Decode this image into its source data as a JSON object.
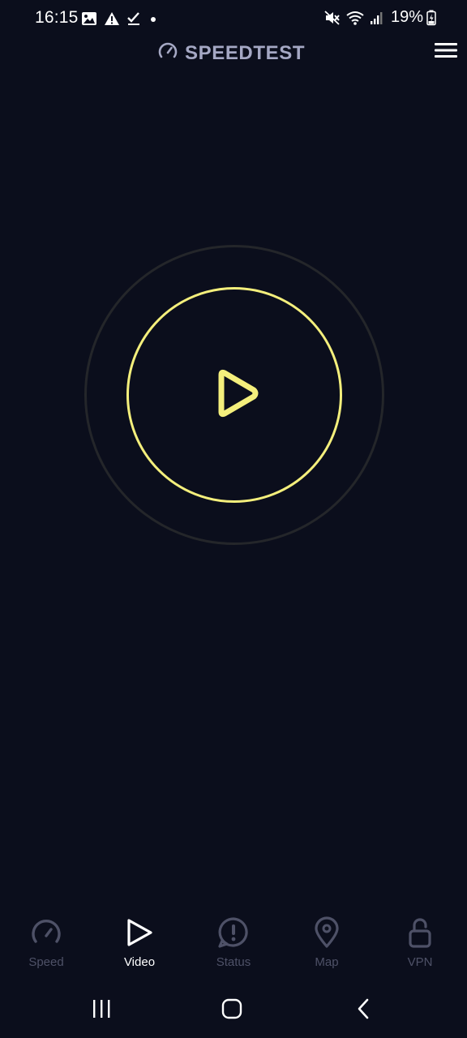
{
  "status_bar": {
    "time": "16:15",
    "battery": "19%",
    "icons": [
      "image-icon",
      "warning-icon",
      "check-icon",
      "dot-icon",
      "mute-icon",
      "wifi-icon",
      "signal-icon",
      "battery-charging-icon"
    ]
  },
  "header": {
    "brand": "SPEEDTEST",
    "logo_icon": "speedometer-icon",
    "menu_icon": "hamburger-menu-icon"
  },
  "main": {
    "start_icon": "play-icon",
    "accent_color": "#f4ef7c",
    "ring_color": "#24262a"
  },
  "bottom_nav": {
    "items": [
      {
        "label": "Speed",
        "icon": "speedometer-icon",
        "active": false
      },
      {
        "label": "Video",
        "icon": "play-icon",
        "active": true
      },
      {
        "label": "Status",
        "icon": "alert-bubble-icon",
        "active": false
      },
      {
        "label": "Map",
        "icon": "map-pin-icon",
        "active": false
      },
      {
        "label": "VPN",
        "icon": "unlock-icon",
        "active": false
      }
    ]
  },
  "system_nav": {
    "buttons": [
      "recent-apps",
      "home",
      "back"
    ]
  },
  "colors": {
    "background": "#0b0e1c",
    "inactive": "#4e5167",
    "brand_text": "#a5a8c4"
  }
}
